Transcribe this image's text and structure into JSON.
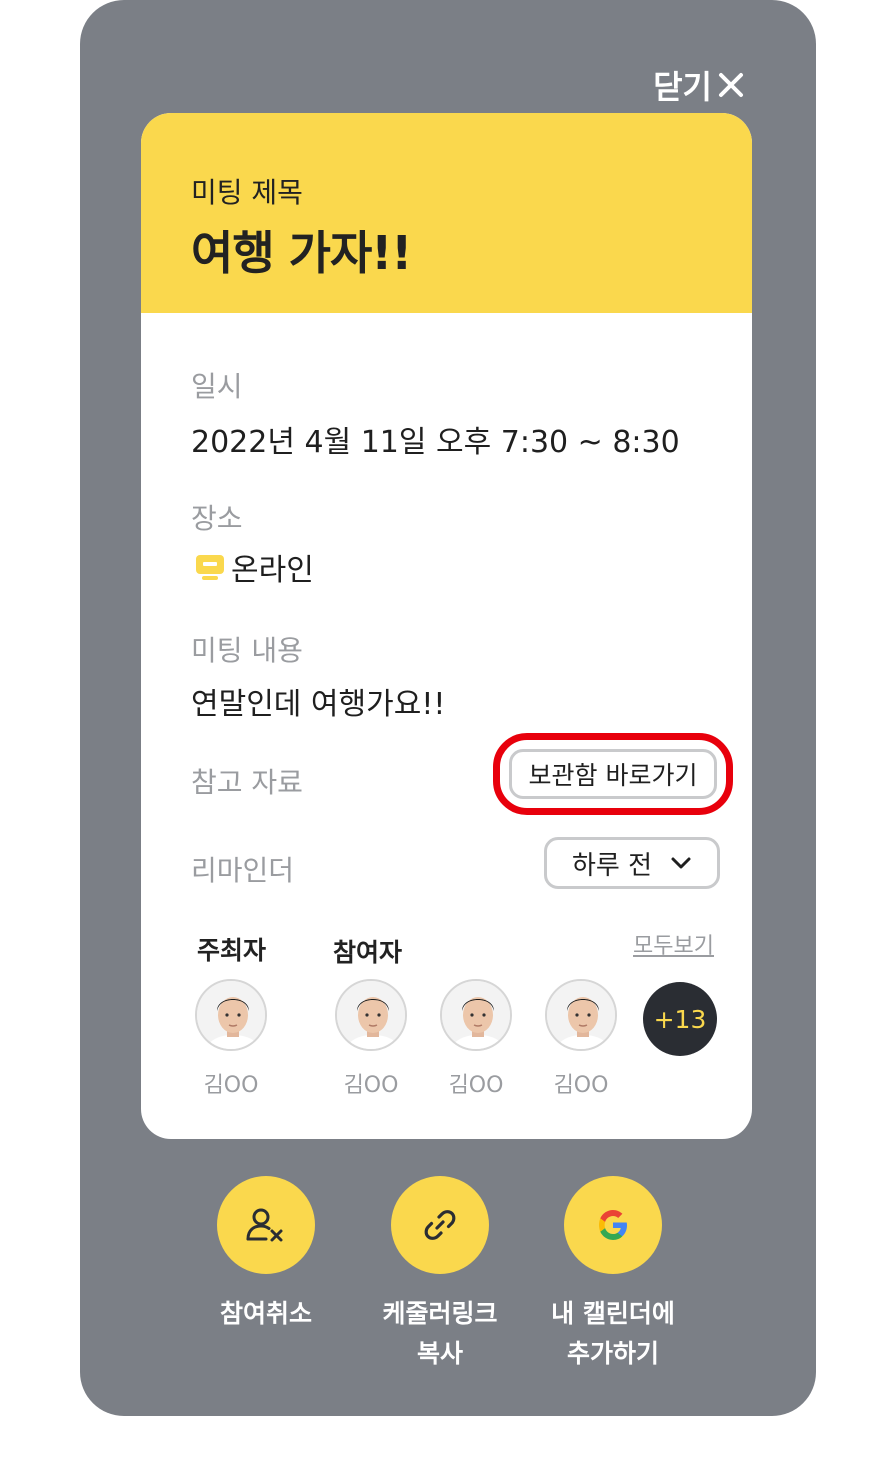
{
  "close": {
    "label": "닫기"
  },
  "meeting": {
    "title_label": "미팅 제목",
    "title": "여행 가자!!",
    "datetime_label": "일시",
    "datetime": "2022년 4월 11일 오후 7:30 ~ 8:30",
    "place_label": "장소",
    "place": "온라인",
    "content_label": "미팅 내용",
    "content": "연말인데 여행가요!!",
    "reference_label": "참고 자료",
    "storage_button": "보관함 바로가기",
    "reminder_label": "리마인더",
    "reminder_value": "하루 전"
  },
  "people": {
    "host_label": "주최자",
    "participants_label": "참여자",
    "see_all": "모두보기",
    "host": {
      "name": "김OO"
    },
    "participants": [
      {
        "name": "김OO"
      },
      {
        "name": "김OO"
      },
      {
        "name": "김OO"
      }
    ],
    "more_count": "+13"
  },
  "actions": [
    {
      "label": "참여취소",
      "icon": "user-remove-icon"
    },
    {
      "label": "케줄러링크\n복사",
      "icon": "link-icon"
    },
    {
      "label": "내 캘린더에\n추가하기",
      "icon": "google-icon"
    }
  ],
  "colors": {
    "accent": "#fad84d",
    "overlay": "#7b7f86",
    "highlight": "#e8000c",
    "dark_badge": "#2a2d33"
  }
}
